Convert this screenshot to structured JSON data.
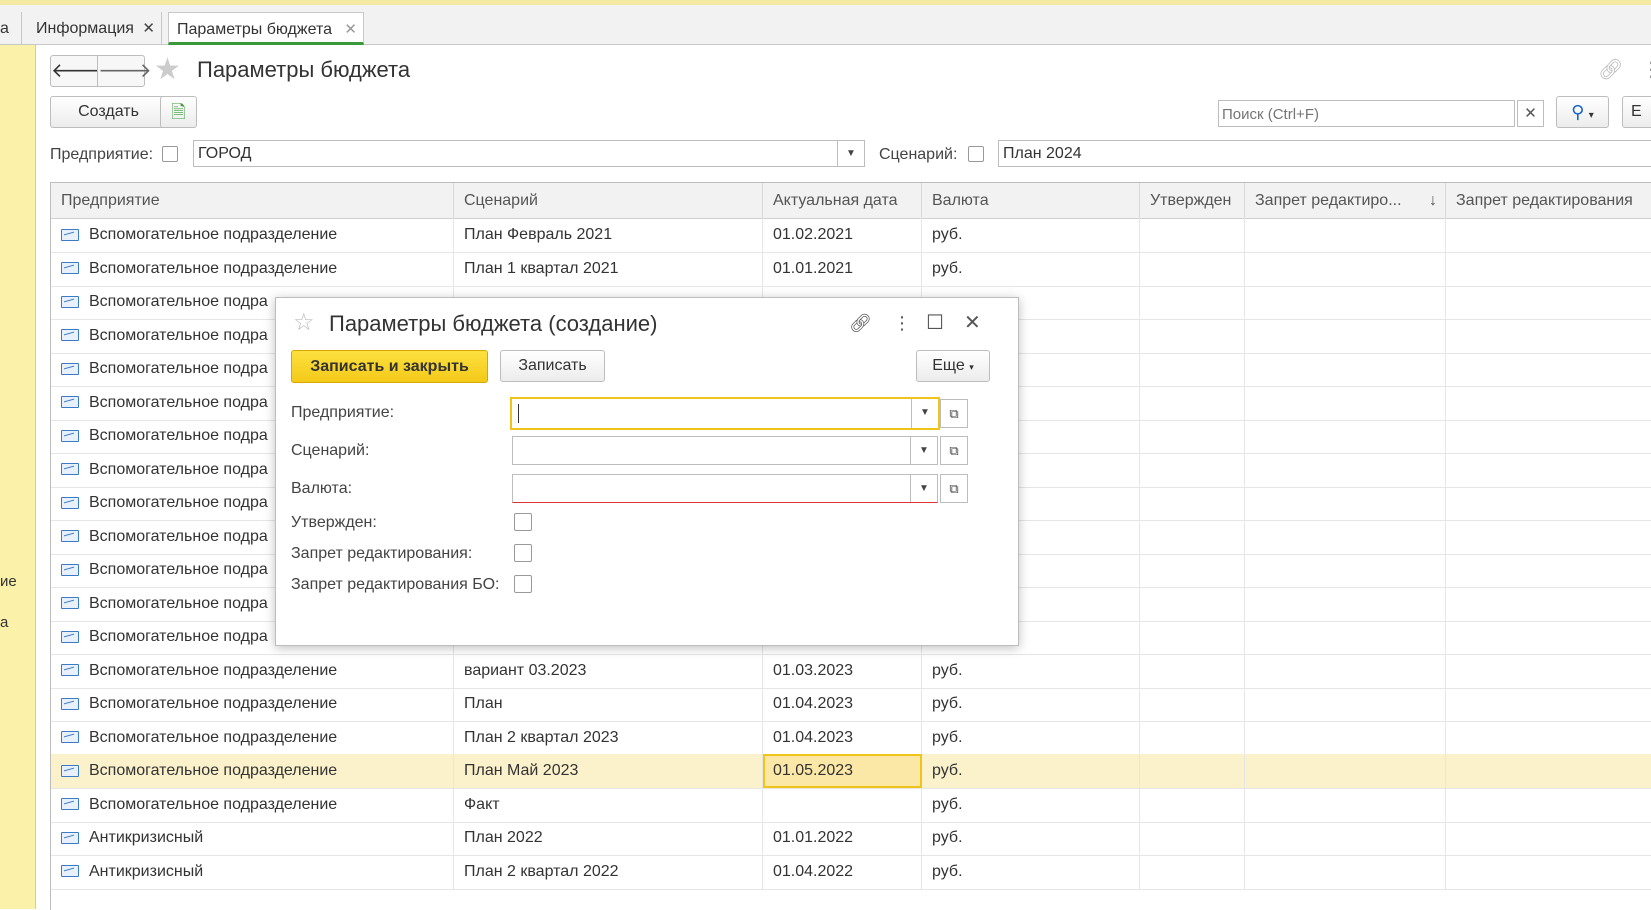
{
  "tabs": [
    {
      "label": "а"
    },
    {
      "label": "Информация"
    },
    {
      "label": "Параметры бюджета"
    }
  ],
  "left_panel": {
    "items": [
      "ие",
      "а"
    ]
  },
  "toolbar": {
    "title": "Параметры бюджета",
    "create_label": "Создать",
    "search_placeholder": "Поиск (Ctrl+F)",
    "more_label": "Е"
  },
  "filters": {
    "enterprise_label": "Предприятие:",
    "enterprise_value": "ГОРОД",
    "scenario_label": "Сценарий:",
    "scenario_value": "План 2024"
  },
  "table": {
    "headers": [
      "Предприятие",
      "Сценарий",
      "Актуальная дата",
      "Валюта",
      "Утвержден",
      "Запрет редактиро...",
      "Запрет редактирования"
    ],
    "sort_indicator": "↓",
    "rows": [
      {
        "enterprise": "Вспомогательное подразделение",
        "scenario": "План Февраль 2021",
        "date": "01.02.2021",
        "currency": "руб."
      },
      {
        "enterprise": "Вспомогательное подразделение",
        "scenario": "План 1 квартал 2021",
        "date": "01.01.2021",
        "currency": "руб."
      },
      {
        "enterprise": "Вспомогательное подра",
        "scenario": "",
        "date": "",
        "currency": ""
      },
      {
        "enterprise": "Вспомогательное подра",
        "scenario": "",
        "date": "",
        "currency": ""
      },
      {
        "enterprise": "Вспомогательное подра",
        "scenario": "",
        "date": "",
        "currency": ""
      },
      {
        "enterprise": "Вспомогательное подра",
        "scenario": "",
        "date": "",
        "currency": ""
      },
      {
        "enterprise": "Вспомогательное подра",
        "scenario": "",
        "date": "",
        "currency": ""
      },
      {
        "enterprise": "Вспомогательное подра",
        "scenario": "",
        "date": "",
        "currency": ""
      },
      {
        "enterprise": "Вспомогательное подра",
        "scenario": "",
        "date": "",
        "currency": ""
      },
      {
        "enterprise": "Вспомогательное подра",
        "scenario": "",
        "date": "",
        "currency": ""
      },
      {
        "enterprise": "Вспомогательное подра",
        "scenario": "",
        "date": "",
        "currency": ""
      },
      {
        "enterprise": "Вспомогательное подра",
        "scenario": "",
        "date": "",
        "currency": ""
      },
      {
        "enterprise": "Вспомогательное подра",
        "scenario": "",
        "date": "",
        "currency": ""
      },
      {
        "enterprise": "Вспомогательное подразделение",
        "scenario": "вариант 03.2023",
        "date": "01.03.2023",
        "currency": "руб."
      },
      {
        "enterprise": "Вспомогательное подразделение",
        "scenario": "План",
        "date": "01.04.2023",
        "currency": "руб."
      },
      {
        "enterprise": "Вспомогательное подразделение",
        "scenario": "План 2 квартал 2023",
        "date": "01.04.2023",
        "currency": "руб."
      },
      {
        "enterprise": "Вспомогательное подразделение",
        "scenario": "План Май 2023",
        "date": "01.05.2023",
        "currency": "руб.",
        "selected": true
      },
      {
        "enterprise": "Вспомогательное подразделение",
        "scenario": "Факт",
        "date": "",
        "currency": "руб."
      },
      {
        "enterprise": "Антикризисный",
        "scenario": "План 2022",
        "date": "01.01.2022",
        "currency": "руб."
      },
      {
        "enterprise": "Антикризисный",
        "scenario": "План 2 квартал 2022",
        "date": "01.04.2022",
        "currency": "руб."
      }
    ]
  },
  "dialog": {
    "title": "Параметры бюджета (создание)",
    "save_close_label": "Записать и закрыть",
    "save_label": "Записать",
    "more_label": "Еще",
    "fields": {
      "enterprise_label": "Предприятие:",
      "scenario_label": "Сценарий:",
      "currency_label": "Валюта:",
      "approved_label": "Утвержден:",
      "edit_ban_label": "Запрет редактирования:",
      "edit_ban_bo_label": "Запрет редактирования БО:"
    }
  },
  "colors": {
    "accent_yellow": "#f4c919",
    "tab_underline": "#3a9a3a",
    "left_panel": "#fbf1a9",
    "selected_row": "#fbf2cc"
  }
}
